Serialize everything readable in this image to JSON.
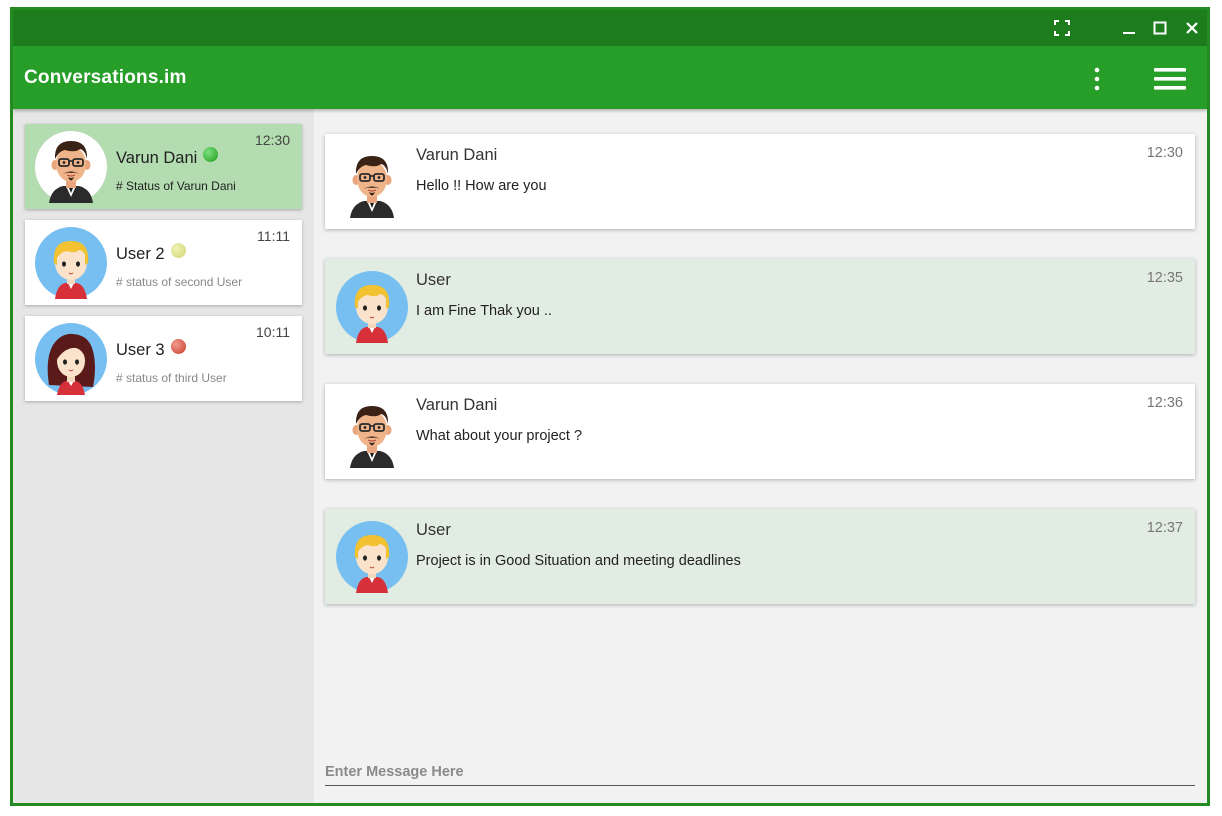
{
  "app": {
    "title": "Conversations.im",
    "colors": {
      "titlebar": "#1d7d1d",
      "appbar": "#279e27",
      "active_contact": "#b3dcb0",
      "incoming_msg": "#e1ece2"
    }
  },
  "window_controls": {
    "icons": [
      "fullscreen-icon",
      "minimize-icon",
      "maximize-icon",
      "close-icon"
    ]
  },
  "appbar_icons": [
    "more-vertical-icon",
    "menu-icon"
  ],
  "contacts": [
    {
      "name": "Varun Dani",
      "status": "# Status of Varun Dani",
      "time": "12:30",
      "presence_color": "#2fb52f",
      "avatar_icon": "avatar-man-beard-icon",
      "active": true
    },
    {
      "name": "User 2",
      "status": "# status of second User",
      "time": "11:11",
      "presence_color": "#d8dc84",
      "avatar_icon": "avatar-blond-boy-icon",
      "active": false
    },
    {
      "name": "User 3",
      "status": "# status of third User",
      "time": "10:11",
      "presence_color": "#d9503f",
      "avatar_icon": "avatar-woman-icon",
      "active": false
    }
  ],
  "messages": [
    {
      "sender": "Varun Dani",
      "text": "Hello !! How are you",
      "time": "12:30",
      "avatar_icon": "avatar-man-beard-icon"
    },
    {
      "sender": "User",
      "text": "I am Fine Thak you ..",
      "time": "12:35",
      "avatar_icon": "avatar-blond-boy-icon"
    },
    {
      "sender": "Varun Dani",
      "text": "What about your project ?",
      "time": "12:36",
      "avatar_icon": "avatar-man-beard-icon"
    },
    {
      "sender": "User",
      "text": "Project is in Good Situation and meeting deadlines",
      "time": "12:37",
      "avatar_icon": "avatar-blond-boy-icon"
    }
  ],
  "composer": {
    "placeholder": "Enter Message Here",
    "value": ""
  }
}
